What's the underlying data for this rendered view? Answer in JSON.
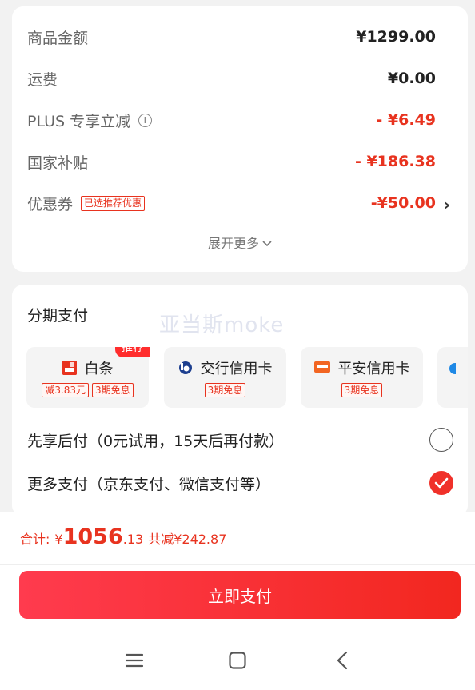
{
  "price": {
    "rows": [
      {
        "label": "商品金额",
        "value": "¥1299.00"
      },
      {
        "label": "运费",
        "value": "¥0.00"
      },
      {
        "label": "PLUS 专享立减",
        "value": "- ¥6.49"
      },
      {
        "label": "国家补贴",
        "value": "- ¥186.38"
      },
      {
        "label": "优惠券",
        "value": "-¥50.00",
        "tag": "已选推荐优惠"
      }
    ],
    "expand_label": "展开更多"
  },
  "payment": {
    "title": "分期支付",
    "watermark": "亚当斯moke",
    "options": [
      {
        "name": "白条",
        "badge": "推荐",
        "tags": [
          "减3.83元",
          "3期免息"
        ]
      },
      {
        "name": "交行信用卡",
        "tags": [
          "3期免息"
        ]
      },
      {
        "name": "平安信用卡",
        "tags": [
          "3期免息"
        ]
      }
    ],
    "methods": [
      {
        "label": "先享后付（0元试用，15天后再付款）",
        "checked": false
      },
      {
        "label": "更多支付（京东支付、微信支付等）",
        "checked": true
      }
    ]
  },
  "summary": {
    "label": "合计:",
    "currency": "¥",
    "total_int": "1056",
    "total_dec": ".13",
    "saved": "共减¥242.87"
  },
  "pay_button": "立即支付",
  "colors": {
    "accent": "#e8331f",
    "button_start": "#ff3b4e",
    "button_end": "#f2271f"
  }
}
